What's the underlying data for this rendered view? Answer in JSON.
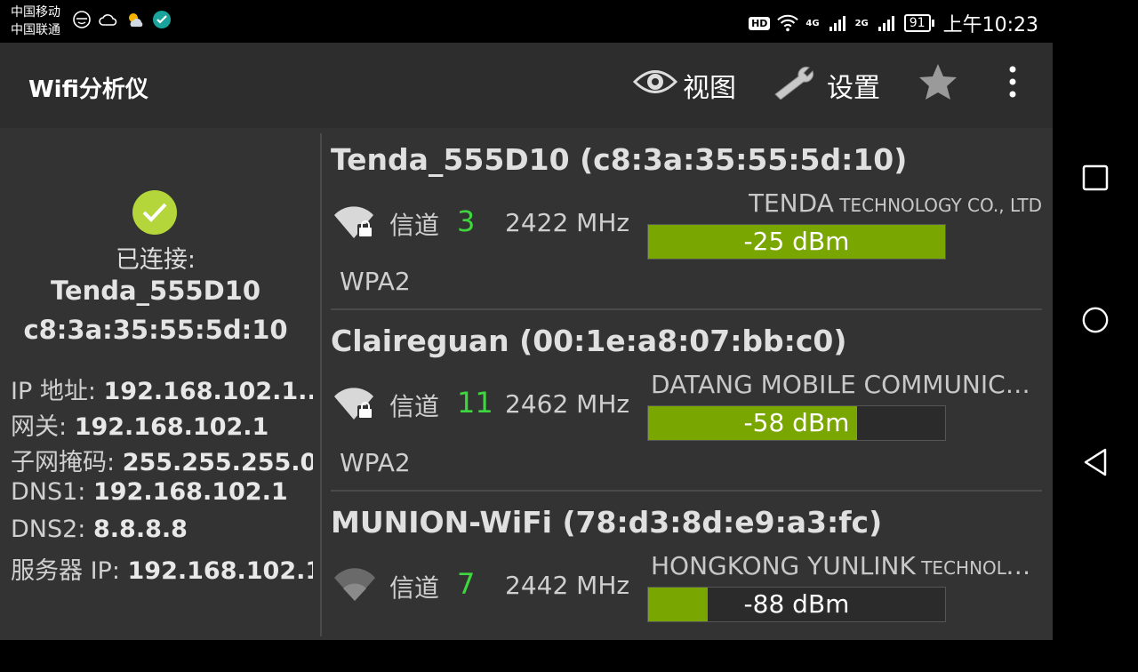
{
  "statusbar": {
    "carrier1": "中国移动",
    "carrier2": "中国联通",
    "hd": "HD",
    "net4g": "4G",
    "net2g": "2G",
    "battery": "91",
    "time": "上午10:23"
  },
  "appbar": {
    "title": "Wifi分析仪",
    "view_label": "视图",
    "settings_label": "设置"
  },
  "connection": {
    "status": "已连接:",
    "ssid": "Tenda_555D10",
    "bssid": "c8:3a:35:55:5d:10",
    "rows": [
      {
        "label": "IP 地址: ",
        "value": "192.168.102.1..."
      },
      {
        "label": "网关: ",
        "value": "192.168.102.1"
      },
      {
        "label": "子网掩码: ",
        "value": "255.255.255.0"
      },
      {
        "label": "DNS1: ",
        "value": "192.168.102.1"
      },
      {
        "label": "DNS2: ",
        "value": "8.8.8.8"
      },
      {
        "label": "服务器 IP: ",
        "value": "192.168.102.1"
      }
    ]
  },
  "networks": [
    {
      "title": "Tenda_555D10 (c8:3a:35:55:5d:10)",
      "channel_label": "信道",
      "channel": "3",
      "freq": "2422 MHz",
      "vendor_main": "TENDA",
      "vendor_small": " TECHNOLOGY CO., LTD",
      "signal": "-25 dBm",
      "signal_fraction": 1.0,
      "security": "WPA2"
    },
    {
      "title": "Claireguan (00:1e:a8:07:bb:c0)",
      "channel_label": "信道",
      "channel": "11",
      "freq": "2462 MHz",
      "vendor_main": "DATANG MOBILE COMMUNICATI...",
      "vendor_small": "",
      "signal": "-58 dBm",
      "signal_fraction": 0.705,
      "security": "WPA2"
    },
    {
      "title": "MUNION-WiFi (78:d3:8d:e9:a3:fc)",
      "channel_label": "信道",
      "channel": "7",
      "freq": "2442 MHz",
      "vendor_main": "HONGKONG YUNLINK",
      "vendor_small": " TECHNOLOGY LI...",
      "signal": "-88 dBm",
      "signal_fraction": 0.2,
      "security": ""
    }
  ],
  "colors": {
    "accent_green": "#3ed83e",
    "signal_bar": "#79a600",
    "check": "#b5d63a"
  }
}
